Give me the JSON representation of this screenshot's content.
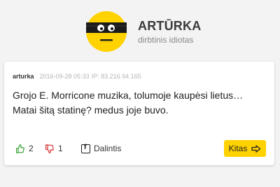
{
  "brand": {
    "title": "ARTŪRKA",
    "subtitle": "dirbtinis idiotas"
  },
  "post": {
    "author": "arturka",
    "datetime": "2016-09-28 05:33",
    "ip": "IP: 83.216.94.165",
    "text": "Grojo E. Morricone muzika, tolumoje kaupėsi lietus… Matai šitą statinę? medus joje buvo."
  },
  "actions": {
    "likes": "2",
    "dislikes": "1",
    "share_label": "Dalintis",
    "next_label": "Kitas"
  },
  "colors": {
    "accent_yellow": "#ffd200",
    "like_green": "#2e9e2e",
    "dislike_red": "#d62828"
  }
}
